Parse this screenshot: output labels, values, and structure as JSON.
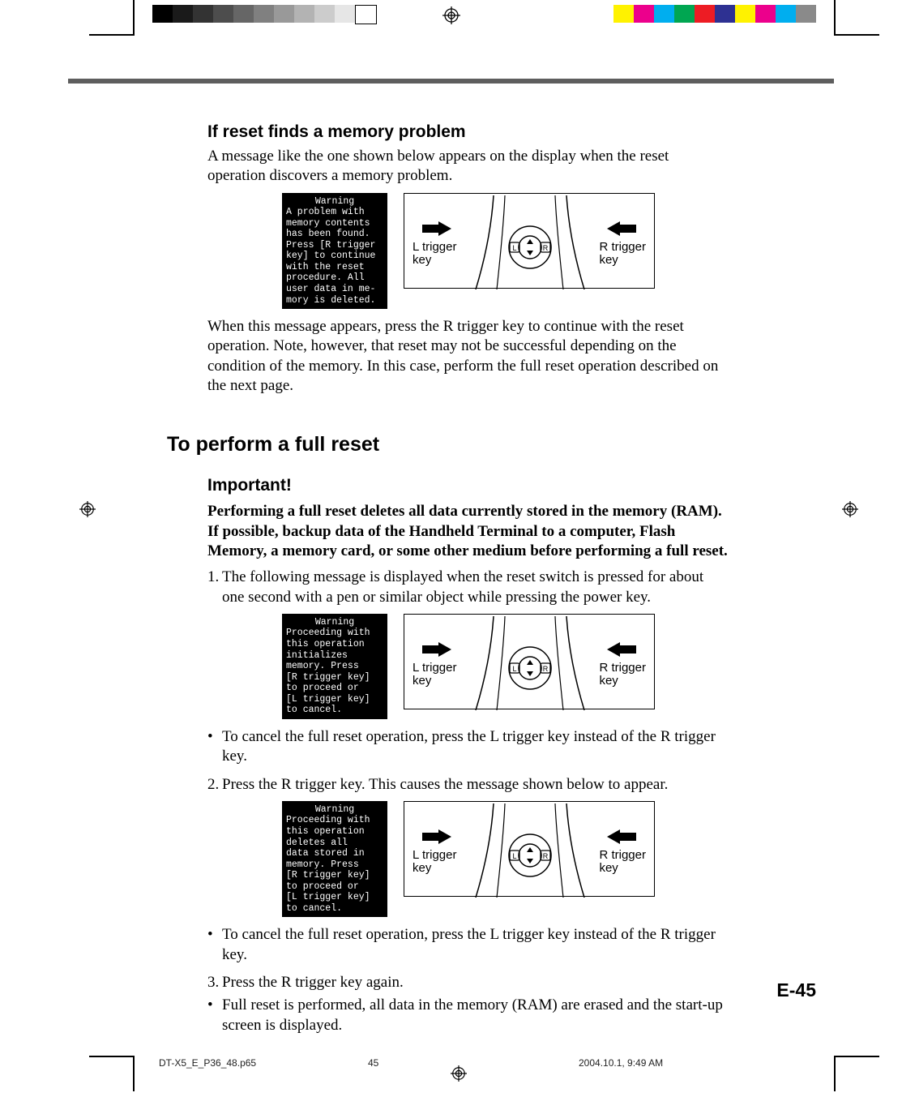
{
  "section1": {
    "heading": "If reset finds a memory problem",
    "intro": "A message like the one shown below appears on the display when the reset operation discovers a memory problem.",
    "after_fig": "When this message appears, press the R trigger key to continue with the reset operation. Note, however, that reset may not be successful depending on the condition of the memory. In this case, perform the full reset operation described on the next page."
  },
  "section2": {
    "heading": "To perform a full reset",
    "important_label": "Important!",
    "important_body": "Performing a full reset deletes all data currently stored in the memory (RAM). If possible, backup data of the Handheld Terminal to a computer, Flash Memory, a memory card, or some other medium before performing a full reset.",
    "step1": "The following message is displayed when the reset switch is pressed for about one second with a pen or similar object while pressing the power key.",
    "step1_bullet": "To cancel the full reset operation, press the L trigger key instead of the R trigger key.",
    "step2": "Press the R trigger key. This causes the message shown below to appear.",
    "step2_bullet": "To cancel the full reset operation, press the L trigger key instead of the R trigger key.",
    "step3": "Press the R trigger key again.",
    "step3_bullet": "Full reset is performed, all data in the memory (RAM) are erased and the start-up screen is displayed."
  },
  "warn_screens": {
    "title": "Warning",
    "s1": "A problem with\nmemory contents\nhas been found.\nPress [R trigger\nkey] to continue\nwith the reset\nprocedure. All\nuser data in me-\nmory is deleted.",
    "s2": "Proceeding with\nthis operation\ninitializes\nmemory. Press\n[R trigger key]\nto proceed or\n[L trigger key]\nto cancel.",
    "s3": "Proceeding with\nthis operation\ndeletes all\ndata stored in\nmemory. Press\n[R trigger key]\nto proceed or\n[L trigger key]\nto cancel."
  },
  "device_labels": {
    "left": "L trigger\nkey",
    "right": "R trigger\nkey",
    "L": "L",
    "R": "R"
  },
  "page_number": "E-45",
  "footer": {
    "file": "DT-X5_E_P36_48.p65",
    "page": "45",
    "timestamp": "2004.10.1, 9:49 AM"
  },
  "gray_swatches": [
    "#000000",
    "#1a1a1a",
    "#333333",
    "#4d4d4d",
    "#666666",
    "#808080",
    "#999999",
    "#b3b3b3",
    "#cccccc",
    "#e6e6e6",
    "#ffffff"
  ],
  "color_swatches": [
    "#fff200",
    "#ec008c",
    "#00aeef",
    "#00a651",
    "#ed1c24",
    "#2e3192",
    "#fff200",
    "#ec008c",
    "#00aeef",
    "#8a8a8a"
  ]
}
